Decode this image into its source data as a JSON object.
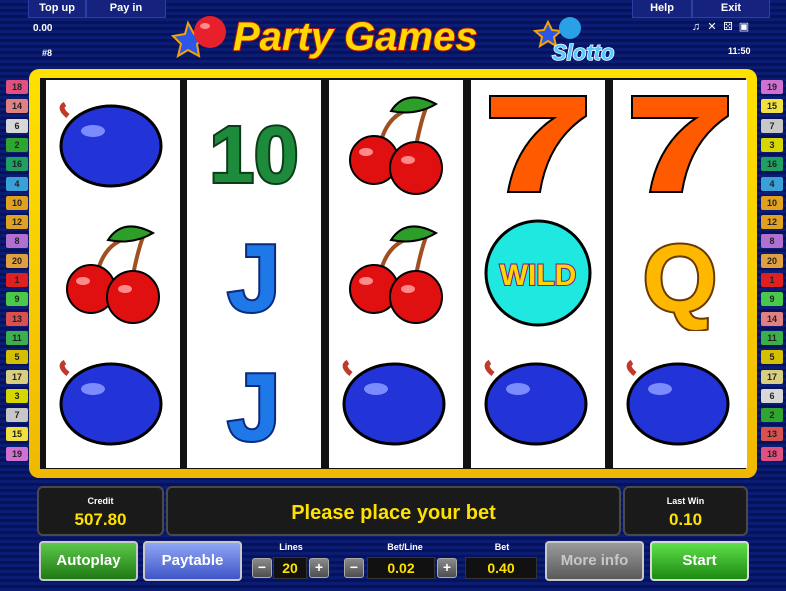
{
  "top": {
    "top_up_label": "Top up",
    "pay_in_label": "Pay in",
    "help_label": "Help",
    "exit_label": "Exit",
    "balance": "0.00",
    "game_number": "#8",
    "clock": "11:50",
    "icons": [
      "music-icon",
      "sound-off-icon",
      "dice-icon",
      "cards-icon"
    ]
  },
  "logo": {
    "line1": "Party Games",
    "line2": "Slotto"
  },
  "left_lines": [
    "18",
    "14",
    "6",
    "2",
    "16",
    "4",
    "10",
    "12",
    "8",
    "20",
    "1",
    "9",
    "13",
    "11",
    "5",
    "17",
    "3",
    "7",
    "15",
    "19"
  ],
  "right_lines": [
    "19",
    "15",
    "7",
    "3",
    "16",
    "4",
    "10",
    "12",
    "8",
    "20",
    "1",
    "9",
    "14",
    "11",
    "5",
    "17",
    "6",
    "2",
    "13",
    "18"
  ],
  "reels": [
    [
      "plum",
      "cherry",
      "plum"
    ],
    [
      "ten",
      "jack",
      "jack"
    ],
    [
      "cherry",
      "cherry",
      "plum"
    ],
    [
      "seven",
      "wild",
      "plum"
    ],
    [
      "seven",
      "queen",
      "plum"
    ]
  ],
  "symbols": {
    "ten": "10",
    "jack": "J",
    "queen": "Q",
    "wild": "WILD"
  },
  "credit": {
    "label": "Credit",
    "value": "507.80"
  },
  "message": "Please place your bet",
  "last_win": {
    "label": "Last Win",
    "value": "0.10"
  },
  "controls": {
    "autoplay_label": "Autoplay",
    "paytable_label": "Paytable",
    "lines_label": "Lines",
    "lines_value": "20",
    "betline_label": "Bet/Line",
    "betline_value": "0.02",
    "bet_label": "Bet",
    "bet_value": "0.40",
    "minus": "−",
    "plus": "+",
    "more_info_label": "More info",
    "start_label": "Start"
  },
  "colors": {
    "frame": "#ffd400",
    "background": "#0a1a6e",
    "accent_yellow": "#ffe100",
    "start_green": "#2aa81a"
  }
}
